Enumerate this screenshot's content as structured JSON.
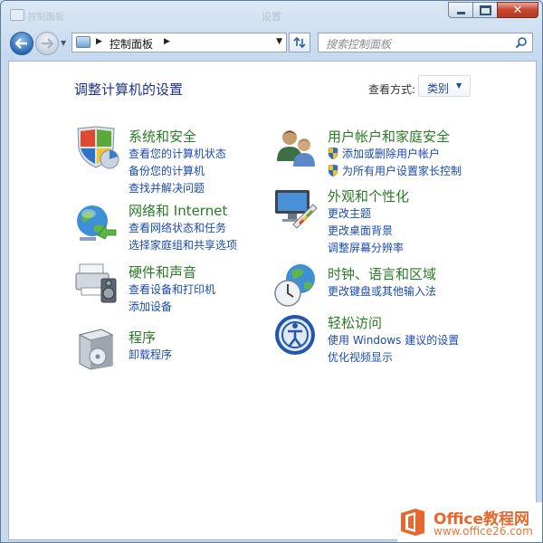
{
  "window": {
    "title": "设置",
    "faded_breadcrumb": "控制面板"
  },
  "navbar": {
    "address_crumb": "控制面板",
    "search_placeholder": "搜索控制面板"
  },
  "main": {
    "heading": "调整计算机的设置",
    "view_by_label": "查看方式:",
    "view_by_value": "类别"
  },
  "categories": [
    {
      "title": "系统和安全",
      "icon": "system-security-icon",
      "links": [
        "查看您的计算机状态",
        "备份您的计算机",
        "查找并解决问题"
      ]
    },
    {
      "title": "网络和 Internet",
      "icon": "network-icon",
      "links": [
        "查看网络状态和任务",
        "选择家庭组和共享选项"
      ]
    },
    {
      "title": "硬件和声音",
      "icon": "hardware-sound-icon",
      "links": [
        "查看设备和打印机",
        "添加设备"
      ]
    },
    {
      "title": "程序",
      "icon": "programs-icon",
      "links": [
        "卸载程序"
      ]
    },
    {
      "title": "用户帐户和家庭安全",
      "icon": "user-accounts-icon",
      "links": [
        "添加或删除用户帐户",
        "为所有用户设置家长控制"
      ]
    },
    {
      "title": "外观和个性化",
      "icon": "appearance-icon",
      "links": [
        "更改主题",
        "更改桌面背景",
        "调整屏幕分辨率"
      ]
    },
    {
      "title": "时钟、语言和区域",
      "icon": "clock-region-icon",
      "links": [
        "更改键盘或其他输入法"
      ]
    },
    {
      "title": "轻松访问",
      "icon": "ease-of-access-icon",
      "links": [
        "使用 Windows 建议的设置",
        "优化视频显示"
      ]
    }
  ],
  "watermark": {
    "brand": "Office教程网",
    "url": "www.office26.com"
  },
  "colors": {
    "category_title": "#2a7a26",
    "link": "#1b4ab0",
    "heading": "#1e3287",
    "watermark": "#e8672c"
  }
}
